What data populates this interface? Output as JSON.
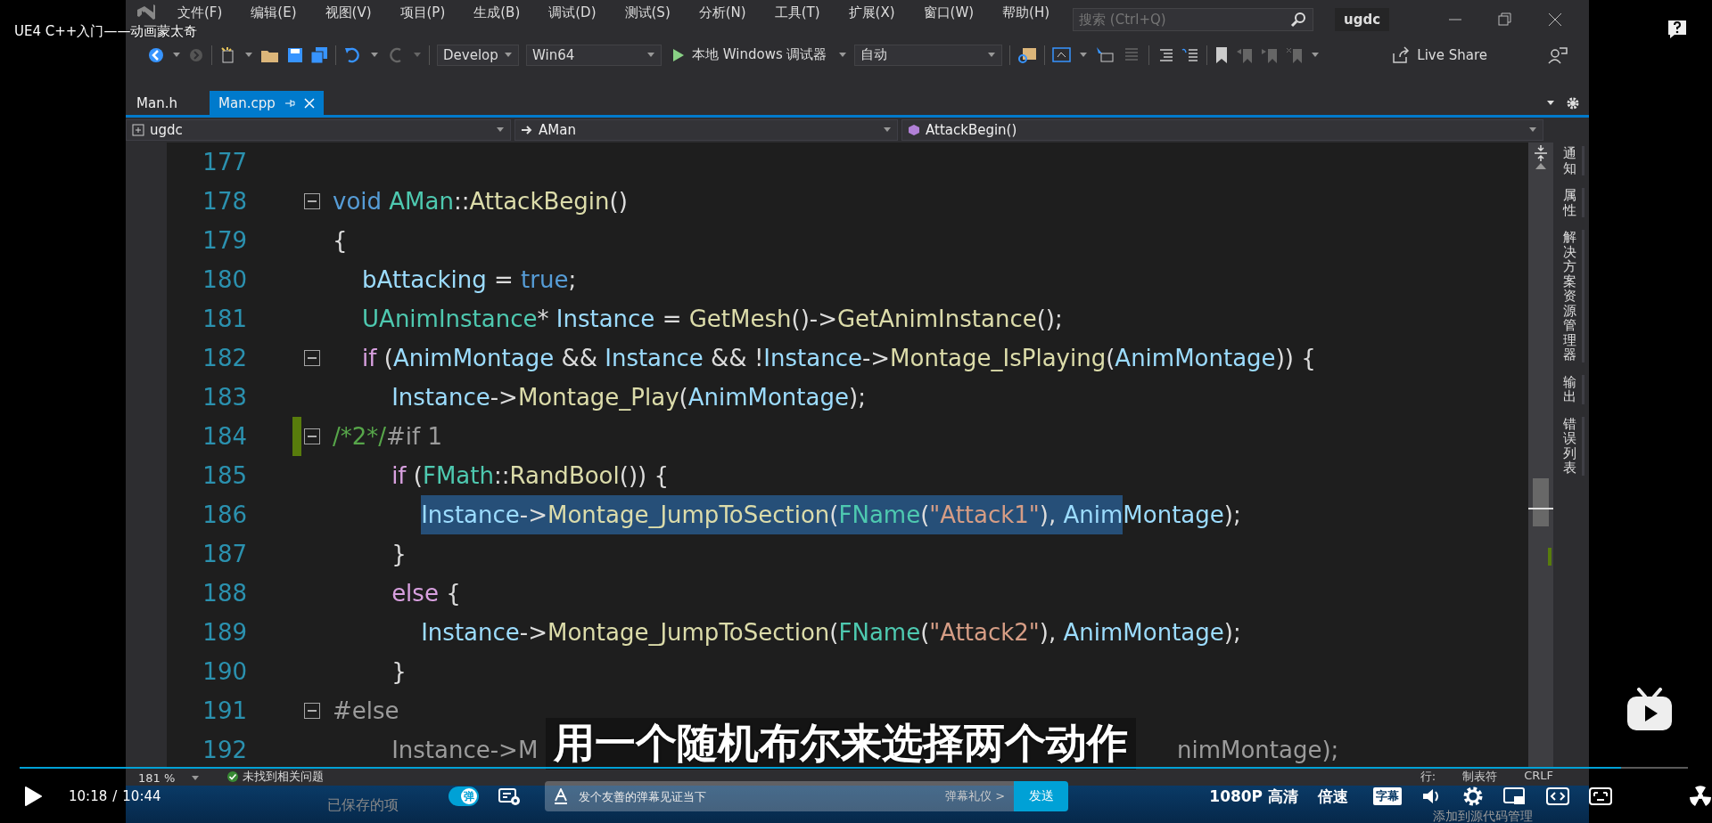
{
  "video_title": "UE4 C++入门——动画蒙太奇",
  "ide": {
    "menu": [
      "文件(F)",
      "编辑(E)",
      "视图(V)",
      "项目(P)",
      "生成(B)",
      "调试(D)",
      "测试(S)",
      "分析(N)",
      "工具(T)",
      "扩展(X)",
      "窗口(W)",
      "帮助(H)"
    ],
    "search": {
      "placeholder": "搜索 (Ctrl+Q)"
    },
    "solution_name": "ugdc",
    "toolbar": {
      "configuration": "Develop",
      "platform": "Win64",
      "debugger": "本地 Windows 调试器",
      "mode": "自动",
      "live_share": "Live Share"
    },
    "tabs": [
      {
        "label": "Man.h",
        "selected": false
      },
      {
        "label": "Man.cpp",
        "selected": true
      }
    ],
    "nav": [
      "ugdc",
      "AMan",
      "AttackBegin()"
    ],
    "code_lines": [
      {
        "number": "177",
        "fold": false,
        "changed": false
      },
      {
        "number": "178",
        "fold": true,
        "changed": false,
        "tokens": [
          {
            "text": "void ",
            "kind": "kw"
          },
          {
            "text": "AMan",
            "kind": "type"
          },
          {
            "text": "::",
            "kind": "punc"
          },
          {
            "text": "AttackBegin",
            "kind": "fn"
          },
          {
            "text": "()",
            "kind": "punc"
          }
        ]
      },
      {
        "number": "179",
        "fold": false,
        "changed": false,
        "tokens": [
          {
            "text": "{",
            "kind": "punc"
          }
        ]
      },
      {
        "number": "180",
        "fold": false,
        "changed": false,
        "tokens": [
          {
            "text": "    bAttacking",
            "kind": "var"
          },
          {
            "text": " = ",
            "kind": "punc"
          },
          {
            "text": "true",
            "kind": "kw"
          },
          {
            "text": ";",
            "kind": "punc"
          }
        ]
      },
      {
        "number": "181",
        "fold": false,
        "changed": false,
        "tokens": [
          {
            "text": "    UAnimInstance",
            "kind": "type"
          },
          {
            "text": "* ",
            "kind": "punc"
          },
          {
            "text": "Instance",
            "kind": "var"
          },
          {
            "text": " = ",
            "kind": "punc"
          },
          {
            "text": "GetMesh",
            "kind": "fn"
          },
          {
            "text": "()->",
            "kind": "punc"
          },
          {
            "text": "GetAnimInstance",
            "kind": "fn"
          },
          {
            "text": "();",
            "kind": "punc"
          }
        ]
      },
      {
        "number": "182",
        "fold": true,
        "changed": false,
        "tokens": [
          {
            "text": "    if ",
            "kind": "kw2"
          },
          {
            "text": "(",
            "kind": "punc"
          },
          {
            "text": "AnimMontage",
            "kind": "var"
          },
          {
            "text": " && ",
            "kind": "punc"
          },
          {
            "text": "Instance",
            "kind": "var"
          },
          {
            "text": " && !",
            "kind": "punc"
          },
          {
            "text": "Instance",
            "kind": "var"
          },
          {
            "text": "->",
            "kind": "punc"
          },
          {
            "text": "Montage_IsPlaying",
            "kind": "fn"
          },
          {
            "text": "(",
            "kind": "punc"
          },
          {
            "text": "AnimMontage",
            "kind": "var"
          },
          {
            "text": ")) {",
            "kind": "punc"
          }
        ]
      },
      {
        "number": "183",
        "fold": false,
        "changed": false,
        "tokens": [
          {
            "text": "        Instance",
            "kind": "var"
          },
          {
            "text": "->",
            "kind": "punc"
          },
          {
            "text": "Montage_Play",
            "kind": "fn"
          },
          {
            "text": "(",
            "kind": "punc"
          },
          {
            "text": "AnimMontage",
            "kind": "var"
          },
          {
            "text": ");",
            "kind": "punc"
          }
        ]
      },
      {
        "number": "184",
        "fold": true,
        "changed": true,
        "tokens": [
          {
            "text": "/*2*/",
            "kind": "cmt"
          },
          {
            "text": "#if 1",
            "kind": "pre"
          }
        ]
      },
      {
        "number": "185",
        "fold": false,
        "changed": false,
        "tokens": [
          {
            "text": "        if ",
            "kind": "kw2"
          },
          {
            "text": "(",
            "kind": "punc"
          },
          {
            "text": "FMath",
            "kind": "type"
          },
          {
            "text": "::",
            "kind": "punc"
          },
          {
            "text": "RandBool",
            "kind": "fn"
          },
          {
            "text": "()) {",
            "kind": "punc"
          }
        ]
      },
      {
        "number": "186",
        "fold": false,
        "changed": false,
        "tokens": [
          {
            "text": "            Instance",
            "kind": "var",
            "selected": true
          },
          {
            "text": "->",
            "kind": "punc",
            "selected": true
          },
          {
            "text": "Montage_JumpToSection",
            "kind": "fn",
            "selected": true
          },
          {
            "text": "(",
            "kind": "punc",
            "selected": true
          },
          {
            "text": "FName",
            "kind": "type",
            "selected": true
          },
          {
            "text": "(",
            "kind": "punc",
            "selected": true
          },
          {
            "text": "\"Attack1\"",
            "kind": "str",
            "selected": true
          },
          {
            "text": "), ",
            "kind": "punc",
            "selected": true
          },
          {
            "text": "Anim",
            "kind": "var",
            "selected": true
          },
          {
            "text": "Montage",
            "kind": "var",
            "selected": false
          },
          {
            "text": ");",
            "kind": "punc",
            "selected": false
          }
        ]
      },
      {
        "number": "187",
        "fold": false,
        "changed": false,
        "tokens": [
          {
            "text": "        }",
            "kind": "punc"
          }
        ]
      },
      {
        "number": "188",
        "fold": false,
        "changed": false,
        "tokens": [
          {
            "text": "        else ",
            "kind": "kw2"
          },
          {
            "text": "{",
            "kind": "punc"
          }
        ]
      },
      {
        "number": "189",
        "fold": false,
        "changed": false,
        "tokens": [
          {
            "text": "            Instance",
            "kind": "var"
          },
          {
            "text": "->",
            "kind": "punc"
          },
          {
            "text": "Montage_JumpToSection",
            "kind": "fn"
          },
          {
            "text": "(",
            "kind": "punc"
          },
          {
            "text": "FName",
            "kind": "type"
          },
          {
            "text": "(",
            "kind": "punc"
          },
          {
            "text": "\"Attack2\"",
            "kind": "str"
          },
          {
            "text": "), ",
            "kind": "punc"
          },
          {
            "text": "AnimMontage",
            "kind": "var"
          },
          {
            "text": ");",
            "kind": "punc"
          }
        ]
      },
      {
        "number": "190",
        "fold": false,
        "changed": false,
        "tokens": [
          {
            "text": "        }",
            "kind": "punc"
          }
        ]
      },
      {
        "number": "191",
        "fold": true,
        "changed": false,
        "tokens": [
          {
            "text": "#else",
            "kind": "pre"
          }
        ]
      },
      {
        "number": "192",
        "fold": false,
        "changed": false,
        "tokens": [
          {
            "text": "        Instance",
            "kind": "dim"
          },
          {
            "text": "->M",
            "kind": "dim"
          }
        ],
        "tail": [
          {
            "text": "nimMontage);",
            "kind": "dim"
          }
        ]
      }
    ],
    "side_tabs": [
      "通知",
      "属性",
      "解决方案资源管理器",
      "输出",
      "错误列表"
    ],
    "status": {
      "zoom": "181 %",
      "issues": "未找到相关问题",
      "line_label": "行:",
      "tabs": "制表符",
      "eol": "CRLF"
    },
    "bottom_status": {
      "left": "已保存的项",
      "right": "添加到源代码管理"
    }
  },
  "subtitle": "用一个随机布尔来选择两个动作",
  "player": {
    "progress": {
      "level": 0.96
    },
    "current_time": "10:18",
    "separator": "/",
    "duration": "10:44",
    "danmaku": {
      "on": true,
      "label": "弹"
    },
    "danmaku_input": {
      "placeholder": "发个友善的弹幕见证当下"
    },
    "etiquette": "弹幕礼仪 >",
    "send": "发送",
    "quality": "1080P 高清",
    "speed": "倍速",
    "subtitles": "字幕"
  }
}
